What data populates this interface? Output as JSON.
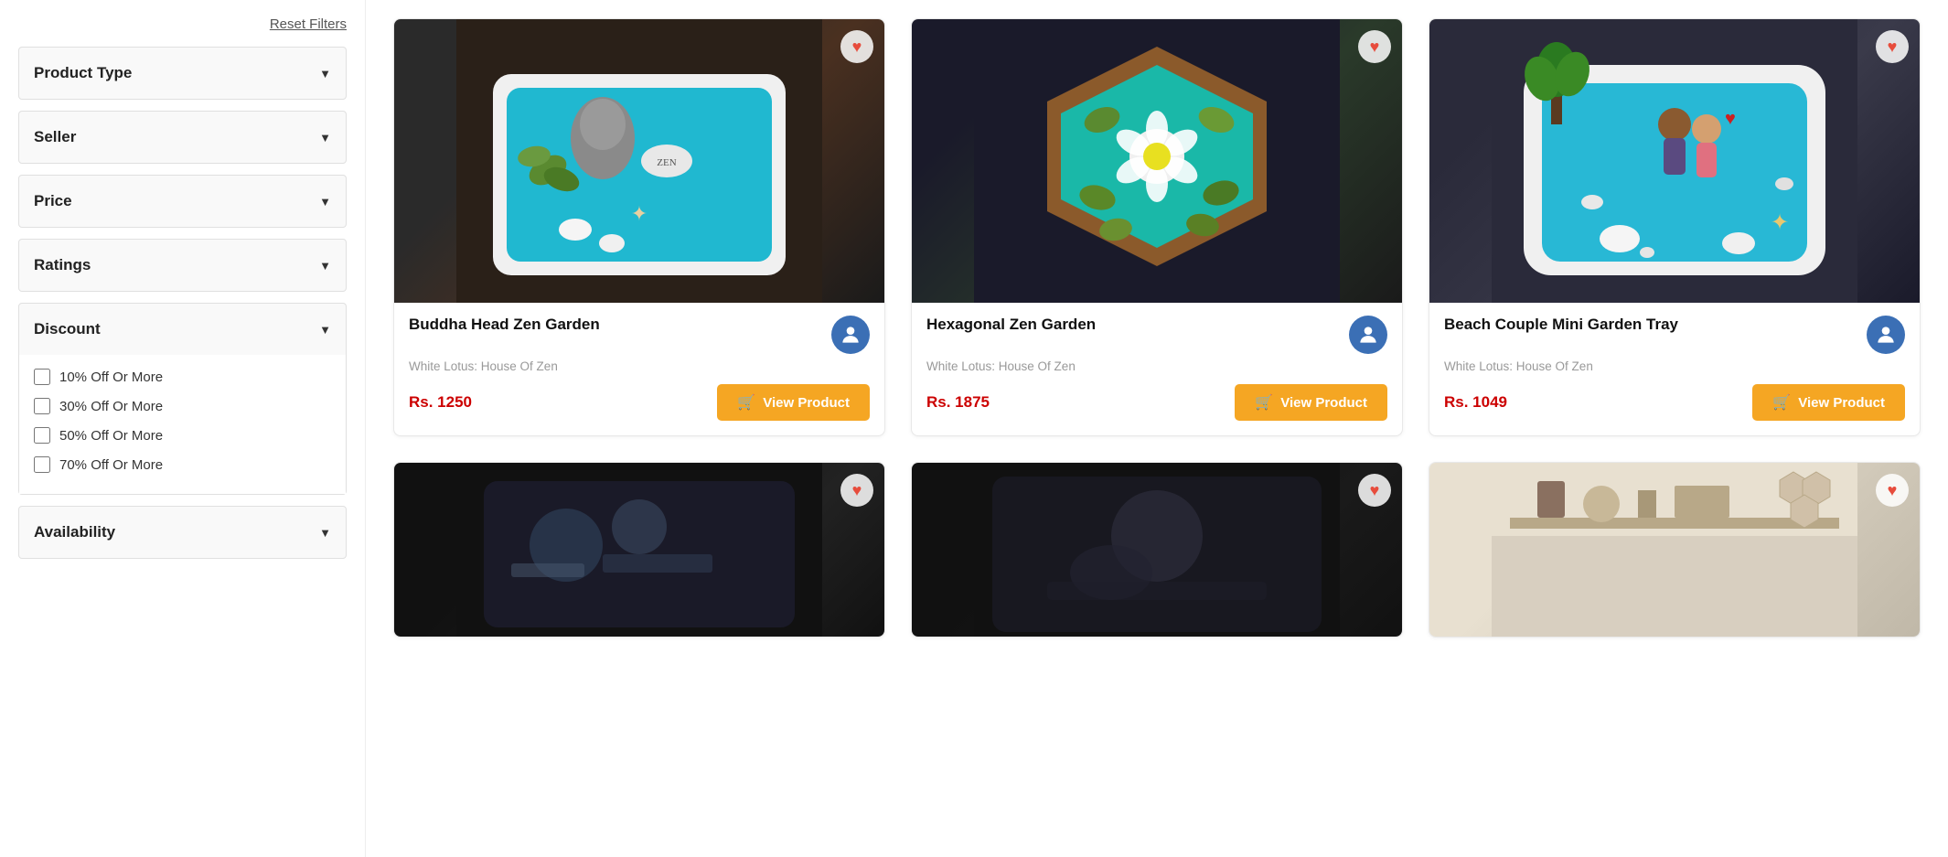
{
  "sidebar": {
    "reset_filters_label": "Reset Filters",
    "filters": [
      {
        "id": "product-type",
        "label": "Product Type",
        "expanded": false
      },
      {
        "id": "seller",
        "label": "Seller",
        "expanded": false
      },
      {
        "id": "price",
        "label": "Price",
        "expanded": false
      },
      {
        "id": "ratings",
        "label": "Ratings",
        "expanded": false
      },
      {
        "id": "discount",
        "label": "Discount",
        "expanded": true
      },
      {
        "id": "availability",
        "label": "Availability",
        "expanded": false
      }
    ],
    "discount_options": [
      {
        "id": "disc-10",
        "label": "10% Off Or More",
        "checked": false
      },
      {
        "id": "disc-30",
        "label": "30% Off Or More",
        "checked": false
      },
      {
        "id": "disc-50",
        "label": "50% Off Or More",
        "checked": false
      },
      {
        "id": "disc-70",
        "label": "70% Off Or More",
        "checked": false
      }
    ]
  },
  "products": [
    {
      "id": "p1",
      "title": "Buddha Head Zen Garden",
      "seller": "White Lotus: House Of Zen",
      "price": "Rs. 1250",
      "image_class": "zen1",
      "partial": false
    },
    {
      "id": "p2",
      "title": "Hexagonal Zen Garden",
      "seller": "White Lotus: House Of Zen",
      "price": "Rs. 1875",
      "image_class": "zen2",
      "partial": false
    },
    {
      "id": "p3",
      "title": "Beach Couple Mini Garden Tray",
      "seller": "White Lotus: House Of Zen",
      "price": "Rs. 1049",
      "image_class": "zen3",
      "partial": false
    },
    {
      "id": "p4",
      "title": "",
      "seller": "",
      "price": "",
      "image_class": "bottom1",
      "partial": true
    },
    {
      "id": "p5",
      "title": "",
      "seller": "",
      "price": "",
      "image_class": "bottom2",
      "partial": true
    },
    {
      "id": "p6",
      "title": "",
      "seller": "",
      "price": "",
      "image_class": "bottom3",
      "partial": true
    }
  ],
  "labels": {
    "view_product": "View Product",
    "wishlist_icon": "♥",
    "cart_icon": "🛒"
  }
}
